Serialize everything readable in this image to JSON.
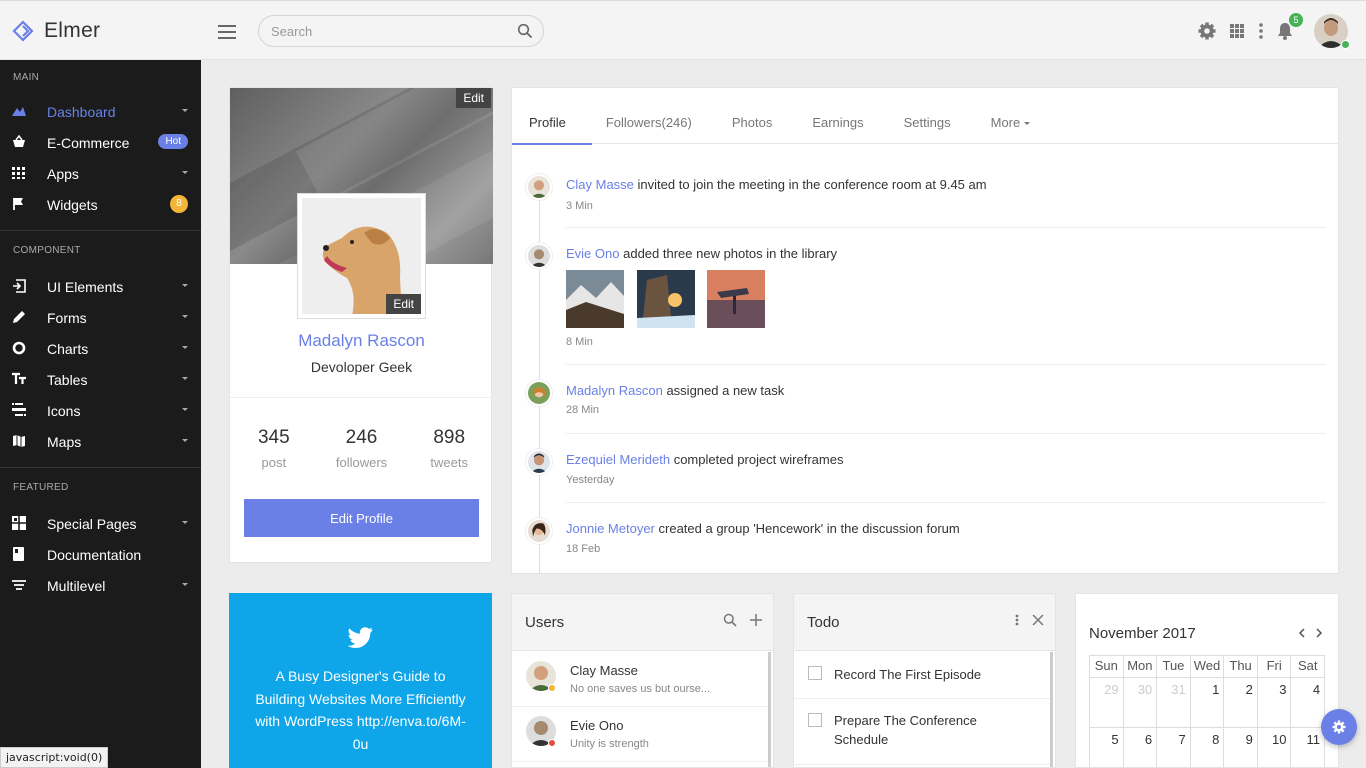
{
  "brand": {
    "name": "Elmer",
    "accent": "#6a80e6"
  },
  "search": {
    "placeholder": "Search",
    "value": ""
  },
  "header": {
    "notification_count": "5"
  },
  "sidebar": {
    "sections": [
      {
        "title": "MAIN",
        "items": [
          {
            "label": "Dashboard",
            "icon": "dashboard-icon",
            "active": true
          },
          {
            "label": "E-Commerce",
            "icon": "basket-icon",
            "badge": "Hot"
          },
          {
            "label": "Apps",
            "icon": "apps-grid-icon"
          },
          {
            "label": "Widgets",
            "icon": "flag-icon",
            "badge": "8"
          }
        ]
      },
      {
        "title": "COMPONENT",
        "items": [
          {
            "label": "UI Elements",
            "icon": "ui-elements-icon"
          },
          {
            "label": "Forms",
            "icon": "pencil-icon"
          },
          {
            "label": "Charts",
            "icon": "donut-chart-icon"
          },
          {
            "label": "Tables",
            "icon": "tables-icon"
          },
          {
            "label": "Icons",
            "icon": "icons-icon"
          },
          {
            "label": "Maps",
            "icon": "map-icon"
          }
        ]
      },
      {
        "title": "FEATURED",
        "items": [
          {
            "label": "Special Pages",
            "icon": "special-pages-icon"
          },
          {
            "label": "Documentation",
            "icon": "book-icon"
          },
          {
            "label": "Multilevel",
            "icon": "filter-icon"
          }
        ]
      }
    ]
  },
  "status_tip": "javascript:void(0)",
  "profile": {
    "cover_edit": "Edit",
    "photo_edit": "Edit",
    "name": "Madalyn Rascon",
    "role": "Devoloper Geek",
    "stats": [
      {
        "value": "345",
        "label": "post"
      },
      {
        "value": "246",
        "label": "followers"
      },
      {
        "value": "898",
        "label": "tweets"
      }
    ],
    "edit_button": "Edit Profile"
  },
  "tabs": [
    "Profile",
    "Followers(246)",
    "Photos",
    "Earnings",
    "Settings",
    "More"
  ],
  "timeline": [
    {
      "name": "Clay Masse",
      "text": "invited to join the meeting in the conference room at 9.45 am",
      "time": "3 Min"
    },
    {
      "name": "Evie Ono",
      "text": "added three new photos in the library",
      "time": "8 Min"
    },
    {
      "name": "Madalyn Rascon",
      "text": "assigned a new task",
      "time": "28 Min"
    },
    {
      "name": "Ezequiel Merideth",
      "text": "completed project wireframes",
      "time": "Yesterday"
    },
    {
      "name": "Jonnie Metoyer",
      "text": "created a group 'Hencework' in the discussion forum",
      "time": "18 Feb"
    }
  ],
  "twitter": {
    "text": "A Busy Designer's Guide to Building Websites More Efficiently with WordPress http://enva.to/6M-0u"
  },
  "users": {
    "title": "Users",
    "list": [
      {
        "name": "Clay Masse",
        "sub": "No one saves us but ourse...",
        "status": "#f3b535"
      },
      {
        "name": "Evie Ono",
        "sub": "Unity is strength",
        "status": "#e74c3c"
      }
    ]
  },
  "todo": {
    "title": "Todo",
    "items": [
      "Record The First Episode",
      "Prepare The Conference Schedule"
    ]
  },
  "calendar": {
    "title": "November 2017",
    "weekdays": [
      "Sun",
      "Mon",
      "Tue",
      "Wed",
      "Thu",
      "Fri",
      "Sat"
    ],
    "week1": [
      "29",
      "30",
      "31",
      "1",
      "2",
      "3",
      "4"
    ],
    "week2": [
      "5",
      "6",
      "7",
      "8",
      "9",
      "10",
      "11"
    ]
  }
}
